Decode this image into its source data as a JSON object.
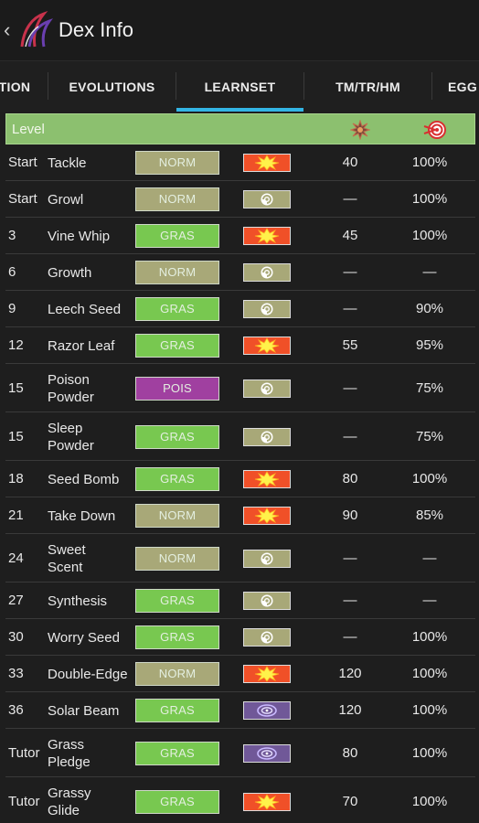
{
  "appbar": {
    "back_glyph": "‹",
    "title": "Dex Info"
  },
  "tabs": [
    {
      "label": "TION",
      "active": false
    },
    {
      "label": "EVOLUTIONS",
      "active": false
    },
    {
      "label": "LEARNSET",
      "active": true
    },
    {
      "label": "TM/TR/HM",
      "active": false
    },
    {
      "label": "EGG",
      "active": false
    }
  ],
  "header": {
    "level_label": "Level",
    "power_icon": "power-icon",
    "accuracy_icon": "accuracy-icon"
  },
  "colors": {
    "NORM": "#a8a878",
    "GRAS": "#78c850",
    "POIS": "#a040a0",
    "physical": "#f05028",
    "status": "#a8a878",
    "special": "#705898",
    "accent": "#33b5e5",
    "header_bg": "#8cc06f"
  },
  "moves": [
    {
      "level": "Start",
      "name": "Tackle",
      "type": "NORM",
      "category": "physical",
      "power": "40",
      "accuracy": "100%"
    },
    {
      "level": "Start",
      "name": "Growl",
      "type": "NORM",
      "category": "status",
      "power": "—",
      "accuracy": "100%"
    },
    {
      "level": "3",
      "name": "Vine Whip",
      "type": "GRAS",
      "category": "physical",
      "power": "45",
      "accuracy": "100%"
    },
    {
      "level": "6",
      "name": "Growth",
      "type": "NORM",
      "category": "status",
      "power": "—",
      "accuracy": "—"
    },
    {
      "level": "9",
      "name": "Leech Seed",
      "type": "GRAS",
      "category": "status",
      "power": "—",
      "accuracy": "90%"
    },
    {
      "level": "12",
      "name": "Razor Leaf",
      "type": "GRAS",
      "category": "physical",
      "power": "55",
      "accuracy": "95%"
    },
    {
      "level": "15",
      "name": "Poison\nPowder",
      "type": "POIS",
      "category": "status",
      "power": "—",
      "accuracy": "75%"
    },
    {
      "level": "15",
      "name": "Sleep\nPowder",
      "type": "GRAS",
      "category": "status",
      "power": "—",
      "accuracy": "75%"
    },
    {
      "level": "18",
      "name": "Seed Bomb",
      "type": "GRAS",
      "category": "physical",
      "power": "80",
      "accuracy": "100%"
    },
    {
      "level": "21",
      "name": "Take Down",
      "type": "NORM",
      "category": "physical",
      "power": "90",
      "accuracy": "85%"
    },
    {
      "level": "24",
      "name": "Sweet\nScent",
      "type": "NORM",
      "category": "status",
      "power": "—",
      "accuracy": "—"
    },
    {
      "level": "27",
      "name": "Synthesis",
      "type": "GRAS",
      "category": "status",
      "power": "—",
      "accuracy": "—"
    },
    {
      "level": "30",
      "name": "Worry Seed",
      "type": "GRAS",
      "category": "status",
      "power": "—",
      "accuracy": "100%"
    },
    {
      "level": "33",
      "name": "Double-Edge",
      "type": "NORM",
      "category": "physical",
      "power": "120",
      "accuracy": "100%"
    },
    {
      "level": "36",
      "name": "Solar Beam",
      "type": "GRAS",
      "category": "special",
      "power": "120",
      "accuracy": "100%"
    },
    {
      "level": "Tutor",
      "name": "Grass\nPledge",
      "type": "GRAS",
      "category": "special",
      "power": "80",
      "accuracy": "100%"
    },
    {
      "level": "Tutor",
      "name": "Grassy\nGlide",
      "type": "GRAS",
      "category": "physical",
      "power": "70",
      "accuracy": "100%"
    }
  ]
}
